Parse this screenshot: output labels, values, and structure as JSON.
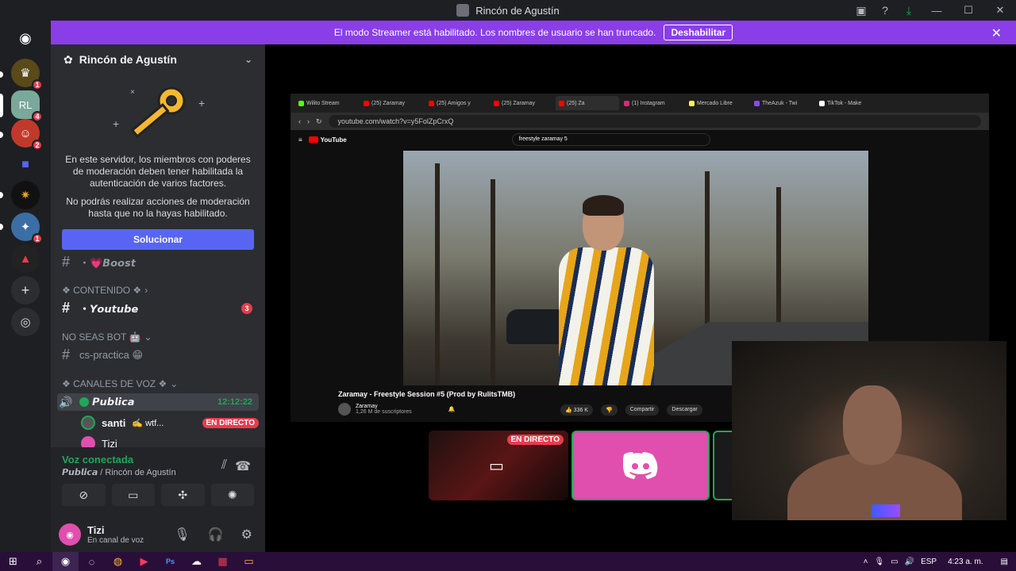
{
  "window": {
    "title": "Rincón de Agustín"
  },
  "banner": {
    "message": "El modo Streamer está habilitado. Los nombres de usuario se han truncado.",
    "button": "Deshabilitar"
  },
  "rail": {
    "badges": [
      "1",
      "4",
      "2",
      "1"
    ]
  },
  "sidebar": {
    "server_name": "Rincón de Agustín",
    "mfa_text_1": "En este servidor, los miembros con poderes de moderación deben tener habilitada la autenticación de varios factores.",
    "mfa_text_2": "No podrás realizar acciones de moderación hasta que no la hayas habilitado.",
    "fix_button": "Solucionar",
    "channel_boost": "・💗𝘽𝙤𝙤𝙨𝙩",
    "category_contenido": "❖ CONTENIDO ❖",
    "channel_youtube": "・𝙔𝙤𝙪𝙩𝙪𝙗𝙚",
    "youtube_badge": "3",
    "category_nobot": "NO SEAS BOT 🤖",
    "channel_practica": "cs-practica 😁",
    "category_voz": "❖ CANALES DE VOZ ❖",
    "voice_channel": "𝙋𝙪𝙗𝙡𝙞𝙘𝙖",
    "voice_timer": "12:12:22",
    "member_1": "santi",
    "member_1_status": "✍️ wtf...",
    "member_1_live": "EN DIRECTO",
    "member_2": "Tizi"
  },
  "voice_panel": {
    "status": "Voz conectada",
    "channel": "𝙋𝙪𝙗𝙡𝙞𝙘𝙖 / Rincón de Agustín",
    "user": "Tizi",
    "user_status": "En canal de voz"
  },
  "stream": {
    "tabs": [
      "Wilito Stream",
      "(25) Zaramay",
      "(25) Amigos y",
      "(25) Zaramay",
      "(25) Za",
      "(1) Instagram",
      "Mercado Libre",
      "TheAzuk - Twi",
      "TikTok - Make"
    ],
    "url": "youtube.com/watch?v=y5FolZpCrxQ",
    "search": "freestyle zaramay 5",
    "video_title": "Zaramay - Freestyle Session #5 (Prod by RulitsTMB)",
    "channel": "Zaramay",
    "subscribers": "1,26 M de suscriptores",
    "likes": "336 K",
    "share": "Compartir",
    "download": "Descargar",
    "live_label": "EN DIRECTO"
  },
  "taskbar": {
    "lang": "ESP",
    "time": "4:23 a. m."
  },
  "colors": {
    "banner": "#8a3ee8",
    "blurple": "#5865f2",
    "green": "#23a55a",
    "red": "#e83c4e",
    "pink": "#e04fae"
  }
}
